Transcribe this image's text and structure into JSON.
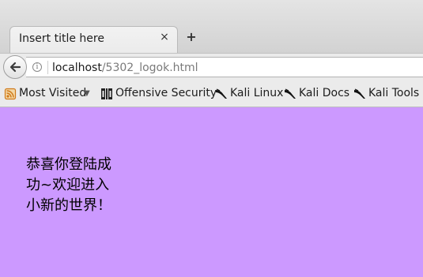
{
  "tab": {
    "title": "Insert title here",
    "close_label": "×",
    "new_tab_label": "+"
  },
  "navbar": {
    "info_label": "i",
    "url_host": "localhost",
    "url_path": "/5302_logok.html"
  },
  "bookmarks": [
    {
      "label": "Most Visited",
      "icon": "most-visited-icon"
    },
    {
      "label": "Offensive Security",
      "icon": "offensive-security-icon"
    },
    {
      "label": "Kali Linux",
      "icon": "kali-dragon-icon"
    },
    {
      "label": "Kali Docs",
      "icon": "kali-dragon-icon"
    },
    {
      "label": "Kali Tools",
      "icon": "kali-dragon-icon"
    }
  ],
  "page": {
    "background": "#cc99ff",
    "message": "恭喜你登陆成功~欢迎进入小新的世界！"
  }
}
